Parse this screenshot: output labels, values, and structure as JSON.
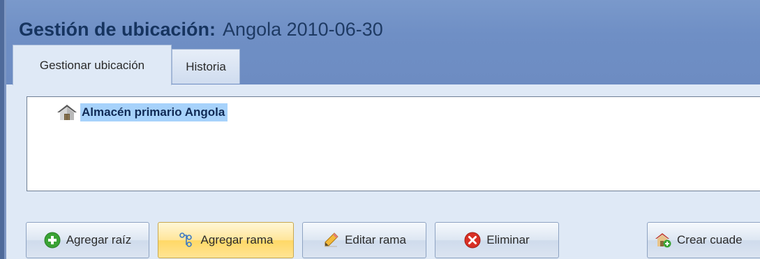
{
  "header": {
    "title_label": "Gestión de ubicación:",
    "title_value": "Angola 2010-06-30"
  },
  "tabs": [
    {
      "label": "Gestionar ubicación",
      "active": true
    },
    {
      "label": "Historia",
      "active": false
    }
  ],
  "tree": {
    "nodes": [
      {
        "label": "Almacén primario Angola",
        "icon": "warehouse-icon",
        "selected": true
      }
    ]
  },
  "toolbar": {
    "add_root_label": "Agregar raíz",
    "add_branch_label": "Agregar rama",
    "edit_branch_label": "Editar rama",
    "delete_label": "Eliminar",
    "create_label": "Crear cuade"
  },
  "colors": {
    "header_bg": "#6f8fc5",
    "content_bg": "#dfe9f6",
    "title_text": "#16345f",
    "selection_bg": "#a7d2fb",
    "add_icon": "#3aa335",
    "delete_icon": "#d93025",
    "hover_button_bg": "#ffe59a"
  }
}
